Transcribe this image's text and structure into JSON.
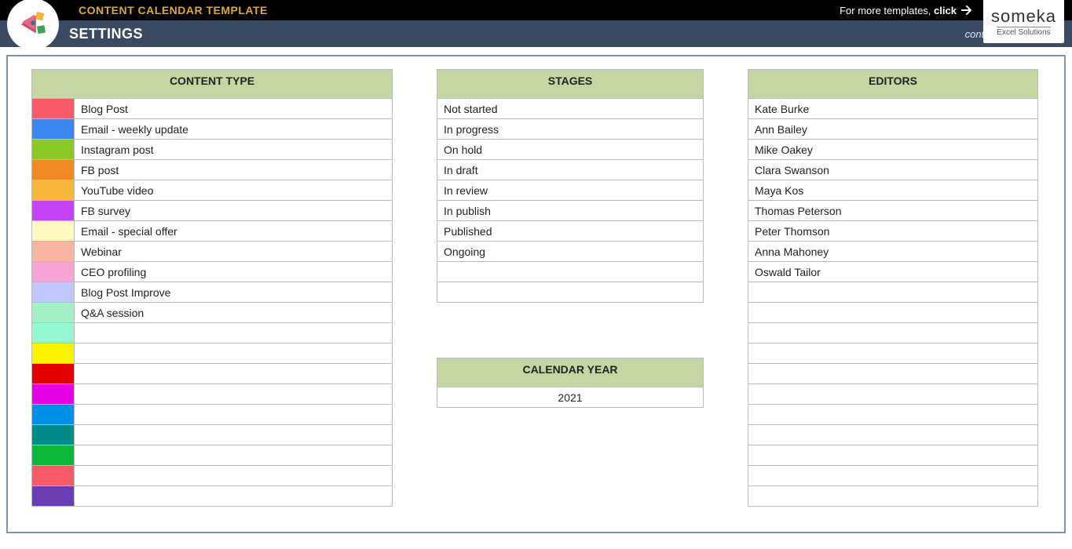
{
  "header": {
    "title": "CONTENT CALENDAR TEMPLATE",
    "more_templates_prefix": "For more templates, ",
    "more_templates_action": "click",
    "brand_main": "someka",
    "brand_sub": "Excel Solutions"
  },
  "subheader": {
    "title": "SETTINGS",
    "contact": "contact@someka.net"
  },
  "content_type": {
    "header": "CONTENT TYPE",
    "rows": [
      {
        "color": "#f95a6a",
        "label": "Blog Post"
      },
      {
        "color": "#3a87f0",
        "label": "Email - weekly update"
      },
      {
        "color": "#8ac926",
        "label": "Instagram post"
      },
      {
        "color": "#f08a24",
        "label": "FB post"
      },
      {
        "color": "#f6b73c",
        "label": "YouTube video"
      },
      {
        "color": "#c542f5",
        "label": "FB survey"
      },
      {
        "color": "#fff8c0",
        "label": "Email - special offer"
      },
      {
        "color": "#f9b5a0",
        "label": "Webinar"
      },
      {
        "color": "#f9a2d4",
        "label": "CEO profiling"
      },
      {
        "color": "#c0c8ff",
        "label": "Blog Post Improve"
      },
      {
        "color": "#a4f0c6",
        "label": "Q&A session"
      },
      {
        "color": "#95f7d0",
        "label": ""
      },
      {
        "color": "#fdf300",
        "label": ""
      },
      {
        "color": "#e20000",
        "label": ""
      },
      {
        "color": "#e600e6",
        "label": ""
      },
      {
        "color": "#008fe6",
        "label": ""
      },
      {
        "color": "#008a8a",
        "label": ""
      },
      {
        "color": "#0bb83a",
        "label": ""
      },
      {
        "color": "#f95a6a",
        "label": ""
      },
      {
        "color": "#6a3db5",
        "label": ""
      }
    ]
  },
  "stages": {
    "header": "STAGES",
    "rows": [
      "Not started",
      "In progress",
      "On hold",
      "In draft",
      "In review",
      "In publish",
      "Published",
      "Ongoing",
      "",
      ""
    ]
  },
  "calendar_year": {
    "header": "CALENDAR YEAR",
    "value": "2021"
  },
  "editors": {
    "header": "EDITORS",
    "rows": [
      "Kate Burke",
      "Ann Bailey",
      "Mike Oakey",
      "Clara Swanson",
      "Maya Kos",
      "Thomas Peterson",
      "Peter Thomson",
      "Anna Mahoney",
      "Oswald Tailor",
      "",
      "",
      "",
      "",
      "",
      "",
      "",
      "",
      "",
      "",
      ""
    ]
  }
}
